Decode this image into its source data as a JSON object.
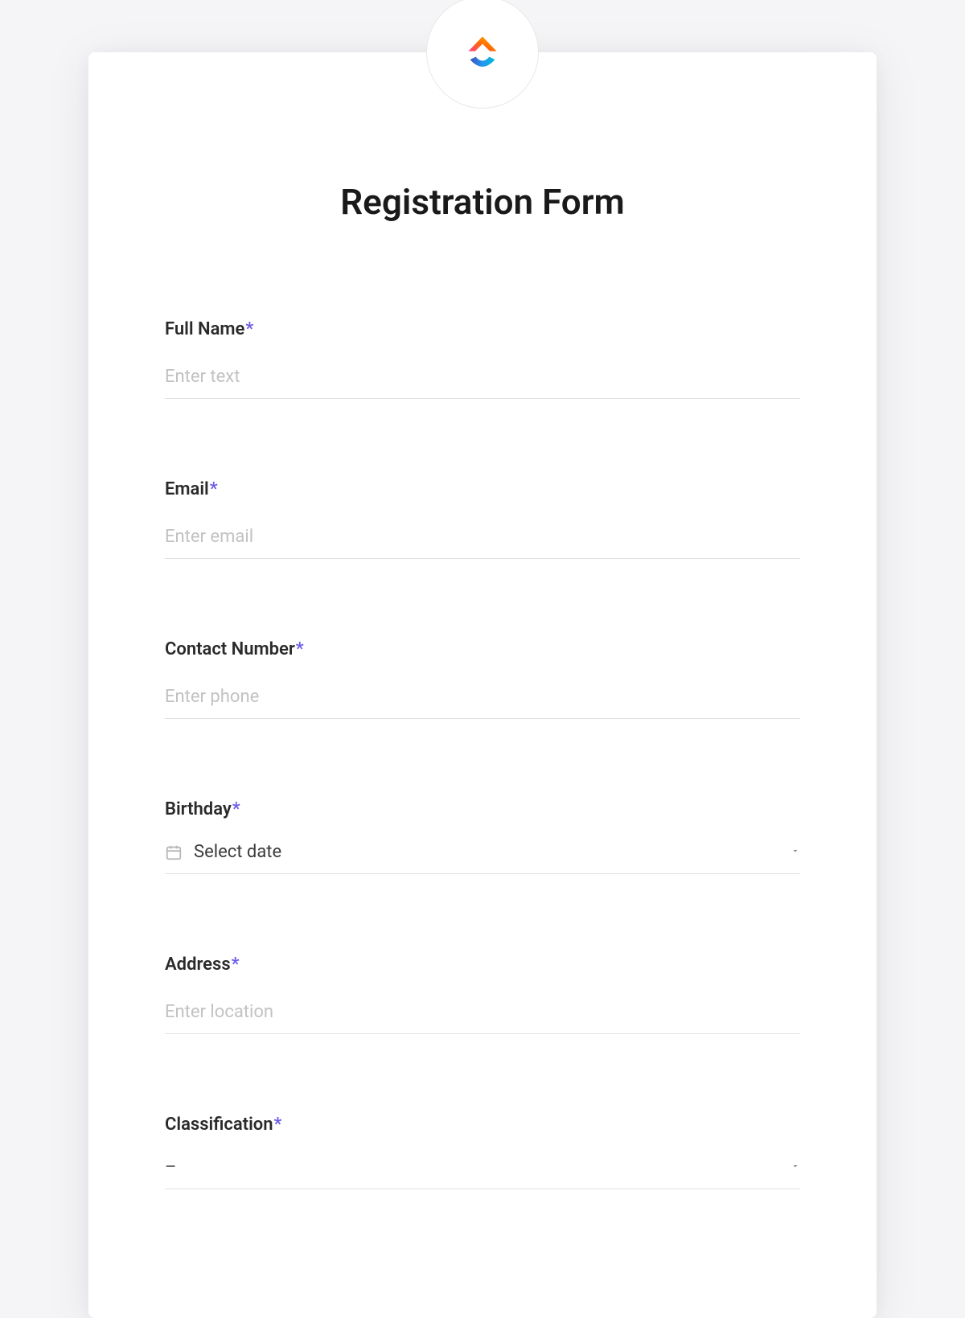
{
  "form": {
    "title": "Registration Form",
    "required_marker": "*",
    "fields": {
      "full_name": {
        "label": "Full Name",
        "placeholder": "Enter text",
        "value": "",
        "required": true
      },
      "email": {
        "label": "Email",
        "placeholder": "Enter email",
        "value": "",
        "required": true
      },
      "contact_number": {
        "label": "Contact Number",
        "placeholder": "Enter phone",
        "value": "",
        "required": true
      },
      "birthday": {
        "label": "Birthday",
        "placeholder": "Select date",
        "value": "",
        "required": true
      },
      "address": {
        "label": "Address",
        "placeholder": "Enter location",
        "value": "",
        "required": true
      },
      "classification": {
        "label": "Classification",
        "placeholder": "–",
        "value": "",
        "required": true
      }
    }
  },
  "icons": {
    "logo": "clickup-logo",
    "calendar": "calendar-icon",
    "chevron_down": "chevron-down-icon"
  }
}
